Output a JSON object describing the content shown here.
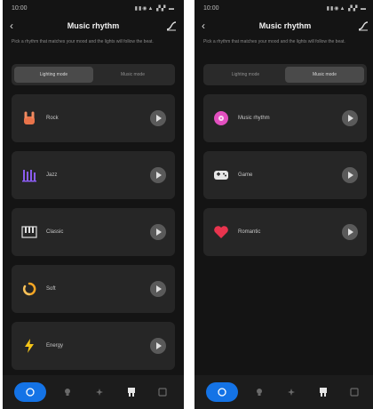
{
  "screens": [
    {
      "status_time": "10:00",
      "status_icons": "▮▮◉▲ ▞▞ ▬",
      "title": "Music rhythm",
      "description": "Pick a rhythm that matches your mood and the lights will follow the beat.",
      "tabs": [
        {
          "label": "Lighting mode",
          "active": true
        },
        {
          "label": "Music mode",
          "active": false
        }
      ],
      "items": [
        {
          "label": "Rock",
          "icon": "rock-hand-icon"
        },
        {
          "label": "Jazz",
          "icon": "jazz-bars-icon"
        },
        {
          "label": "Classic",
          "icon": "piano-keys-icon"
        },
        {
          "label": "Soft",
          "icon": "soft-swirl-icon"
        },
        {
          "label": "Energy",
          "icon": "lightning-icon"
        }
      ]
    },
    {
      "status_time": "10:00",
      "status_icons": "▮▮◉▲ ▞▞ ▬",
      "title": "Music rhythm",
      "description": "Pick a rhythm that matches your mood and the lights will follow the beat.",
      "tabs": [
        {
          "label": "Lighting mode",
          "active": false
        },
        {
          "label": "Music mode",
          "active": true
        }
      ],
      "items": [
        {
          "label": "Music rhythm",
          "icon": "record-disc-icon"
        },
        {
          "label": "Game",
          "icon": "gamepad-icon"
        },
        {
          "label": "Romantic",
          "icon": "heart-lips-icon"
        }
      ]
    }
  ],
  "colors": {
    "background": "#141414",
    "card": "#262626",
    "accent_blue": "#1473e6",
    "rock": "#e8734a",
    "jazz": "#8a5cf0",
    "soft": "#f5a623",
    "energy": "#f5c518",
    "record": "#e24fbf",
    "romantic": "#e8344e"
  },
  "nav_icons": [
    "home-icon",
    "bulb-icon",
    "scene-icon",
    "device-icon",
    "menu-icon"
  ]
}
